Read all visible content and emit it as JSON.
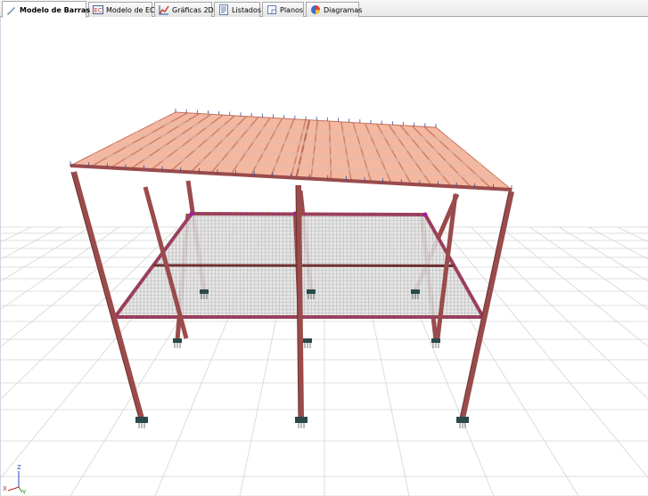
{
  "tabs": [
    {
      "label": "Modelo de Barras",
      "icon": "pencil-icon",
      "active": true
    },
    {
      "label": "Modelo de EC",
      "icon": "ec-model-icon",
      "active": false
    },
    {
      "label": "Gráficas 2D",
      "icon": "chart-2d-icon",
      "active": false
    },
    {
      "label": "Listados",
      "icon": "list-icon",
      "active": false
    },
    {
      "label": "Planos",
      "icon": "drawing-sheet-icon",
      "active": false
    },
    {
      "label": "Diagramas",
      "icon": "diagram-icon",
      "active": false
    }
  ],
  "axis_triad": {
    "z": "Z",
    "x": "X",
    "y": "Y"
  },
  "colors": {
    "column": "#9a4b4b",
    "column_dark": "#6e3030",
    "roof": "#f0a082",
    "mesh": "#8c8c8c",
    "node": "#a020a0",
    "grid": "#d5d5d5",
    "support": "#2a4a4a"
  }
}
